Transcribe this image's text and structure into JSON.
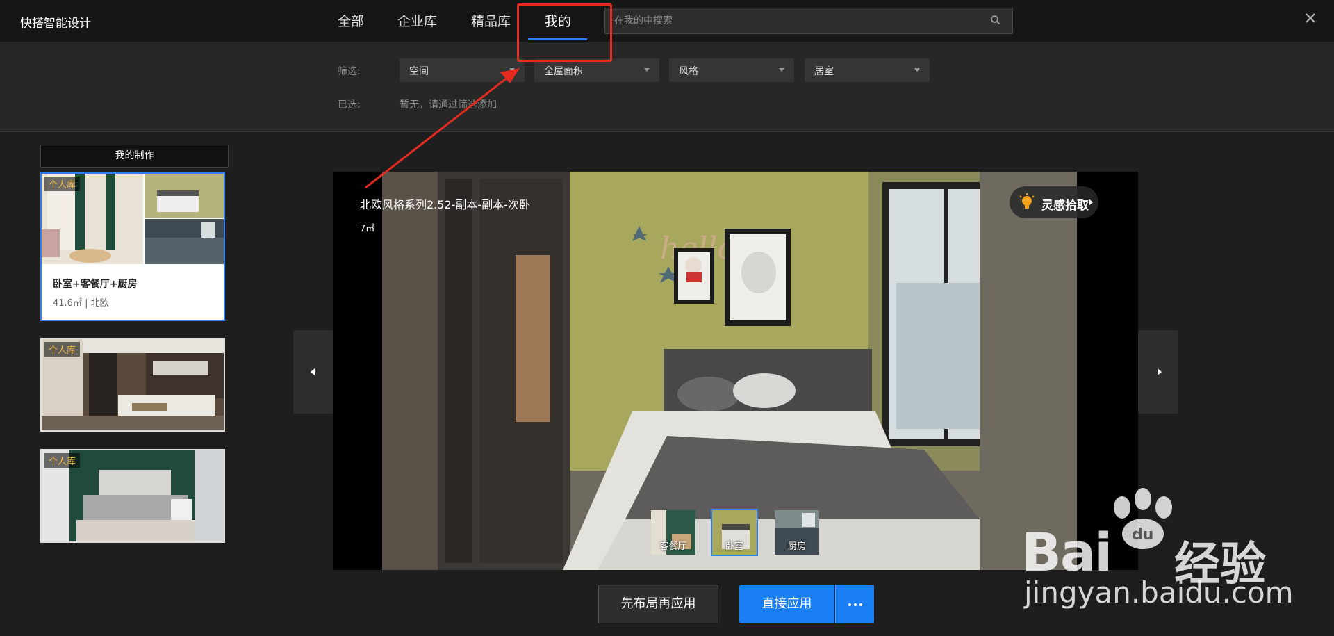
{
  "app": {
    "title": "快搭智能设计"
  },
  "tabs": [
    {
      "label": "全部"
    },
    {
      "label": "企业库"
    },
    {
      "label": "精品库"
    },
    {
      "label": "我的"
    }
  ],
  "active_tab": "我的",
  "search": {
    "placeholder": "在我的中搜索",
    "value": ""
  },
  "filters": {
    "label": "筛选:",
    "dropdowns": [
      {
        "selected": "空间"
      },
      {
        "selected": "全屋面积"
      },
      {
        "selected": "风格"
      },
      {
        "selected": "居室"
      }
    ],
    "selected_label": "已选:",
    "selected_note": "暂无，请通过筛选添加"
  },
  "sidebar": {
    "header": "我的制作",
    "cards": [
      {
        "badge": "个人库",
        "title": "卧室+客餐厅+厨房",
        "meta": "41.6㎡ | 北欧",
        "active": true
      },
      {
        "badge": "个人库"
      },
      {
        "badge": "个人库"
      }
    ]
  },
  "viewer": {
    "title": "北欧风格系列2.52-副本-副本-次卧",
    "area": "7㎡",
    "inspiration_label": "灵感拾取",
    "rooms": [
      {
        "label": "客餐厅"
      },
      {
        "label": "卧室"
      },
      {
        "label": "厨房"
      }
    ],
    "active_room": "卧室"
  },
  "actions": {
    "layout_then_apply": "先布局再应用",
    "apply_direct": "直接应用"
  },
  "watermark": {
    "brand": "Bai",
    "brand_cn": "经验",
    "url": "jingyan.baidu.com"
  },
  "colors": {
    "accent": "#1a7ef5",
    "annotation": "#e52b20",
    "badge_text": "#f0b944"
  }
}
